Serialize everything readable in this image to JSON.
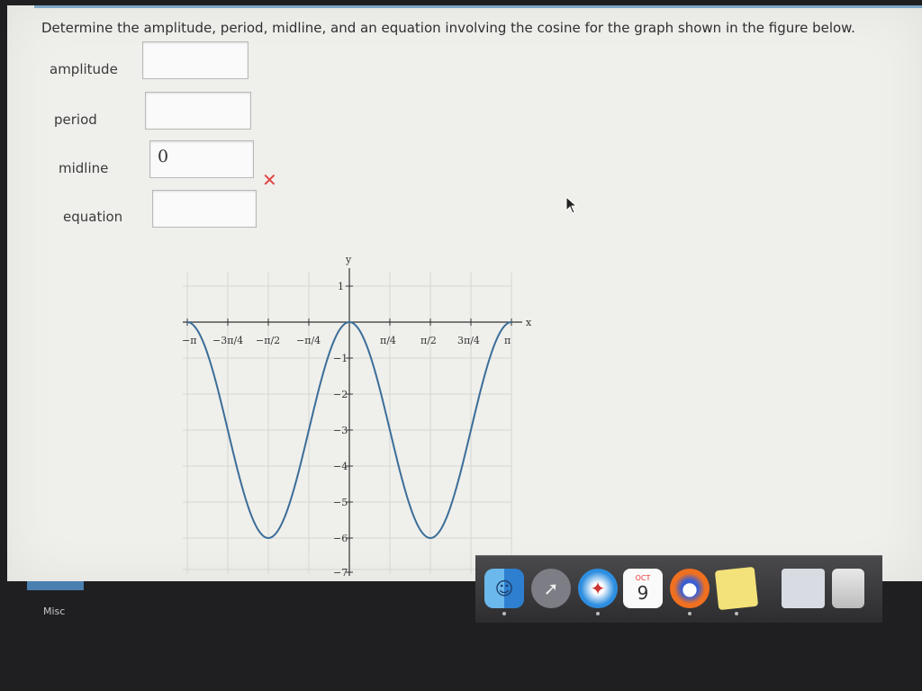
{
  "question": "Determine the amplitude, period, midline, and an equation involving the cosine for the graph shown in the figure below.",
  "fields": [
    {
      "label": "amplitude",
      "value": ""
    },
    {
      "label": "period",
      "value": ""
    },
    {
      "label": "midline",
      "value": "0"
    },
    {
      "label": "equation",
      "value": ""
    }
  ],
  "incorrect_mark": "✕",
  "graph": {
    "x_axis_label": "x",
    "y_axis_label": "y",
    "x_tick_labels": [
      "−π",
      "−3π/4",
      "−π/2",
      "−π/4",
      "π/4",
      "π/2",
      "3π/4",
      "π"
    ],
    "y_tick_labels": [
      "1",
      "−1",
      "−2",
      "−3",
      "−4",
      "−5",
      "−6",
      "−7"
    ],
    "curve": {
      "form": "y = 3cos(2x) − 3",
      "max": 0,
      "min": -6,
      "color": "#3b6e99"
    }
  },
  "dock": {
    "items": [
      "finder-icon",
      "launchpad-icon",
      "safari-icon",
      "calendar-icon",
      "firefox-icon",
      "stickies-icon",
      "preview-icon",
      "trash-icon"
    ],
    "calendar_month": "OCT",
    "calendar_day": "9"
  },
  "sidebar_label": "Misc"
}
